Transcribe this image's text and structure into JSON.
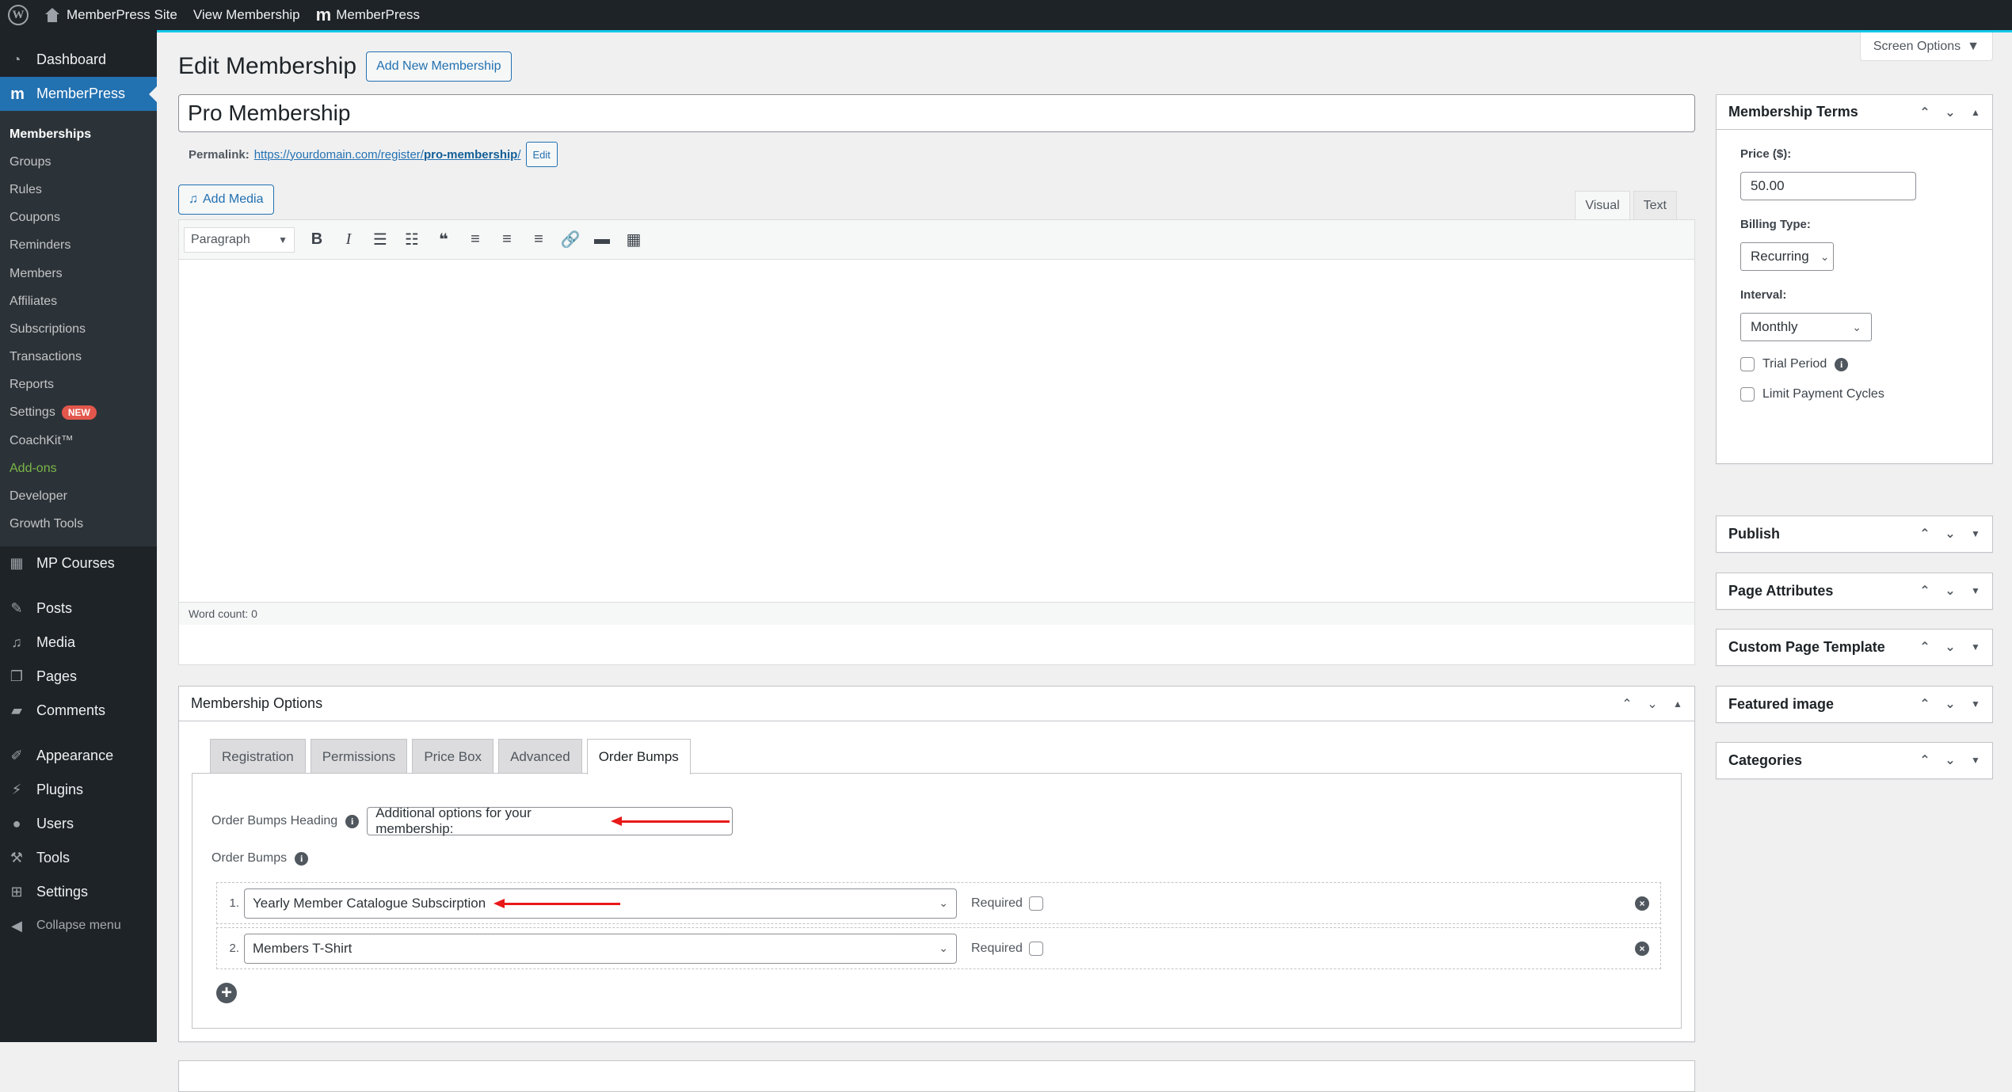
{
  "adminbar": {
    "site_name": "MemberPress Site",
    "view_link": "View Membership",
    "plugin_link": "MemberPress"
  },
  "sidebar": {
    "top_items": [
      {
        "label": "Dashboard",
        "icon": "dashboard-icon"
      },
      {
        "label": "MemberPress",
        "icon": "memberpress-icon",
        "active": true
      }
    ],
    "submenu": [
      {
        "label": "Memberships",
        "current": true
      },
      {
        "label": "Groups"
      },
      {
        "label": "Rules"
      },
      {
        "label": "Coupons"
      },
      {
        "label": "Reminders"
      },
      {
        "label": "Members"
      },
      {
        "label": "Affiliates"
      },
      {
        "label": "Subscriptions"
      },
      {
        "label": "Transactions"
      },
      {
        "label": "Reports"
      },
      {
        "label": "Settings",
        "badge": "NEW"
      },
      {
        "label": "CoachKit™"
      },
      {
        "label": "Add-ons",
        "color": "#7ab648"
      },
      {
        "label": "Developer"
      },
      {
        "label": "Growth Tools"
      }
    ],
    "mp_courses": "MP Courses",
    "bottom_items": [
      {
        "label": "Posts",
        "icon": "pin-icon"
      },
      {
        "label": "Media",
        "icon": "media-icon"
      },
      {
        "label": "Pages",
        "icon": "pages-icon"
      },
      {
        "label": "Comments",
        "icon": "comment-icon"
      },
      {
        "label": "Appearance",
        "icon": "brush-icon"
      },
      {
        "label": "Plugins",
        "icon": "plug-icon"
      },
      {
        "label": "Users",
        "icon": "user-icon"
      },
      {
        "label": "Tools",
        "icon": "wrench-icon"
      },
      {
        "label": "Settings",
        "icon": "settings-icon"
      }
    ],
    "collapse": "Collapse menu"
  },
  "header": {
    "title": "Edit Membership",
    "add_new": "Add New Membership",
    "screen_options": "Screen Options"
  },
  "post": {
    "title": "Pro Membership",
    "permalink_label": "Permalink:",
    "permalink_base": "https://yourdomain.com/register/",
    "permalink_slug": "pro-membership",
    "permalink_trail": "/",
    "permalink_edit": "Edit"
  },
  "editor": {
    "add_media": "Add Media",
    "tabs": [
      "Visual",
      "Text"
    ],
    "active_tab": "Visual",
    "format": "Paragraph",
    "word_count": "Word count: 0"
  },
  "membership_options": {
    "title": "Membership Options",
    "tabs": [
      "Registration",
      "Permissions",
      "Price Box",
      "Advanced",
      "Order Bumps"
    ],
    "active_tab": "Order Bumps",
    "heading_label": "Order Bumps Heading",
    "heading_value": "Additional options for your membership:",
    "bumps_label": "Order Bumps",
    "required_label": "Required",
    "bumps": [
      {
        "num": "1.",
        "value": "Yearly Member Catalogue Subscirption",
        "required": false
      },
      {
        "num": "2.",
        "value": "Members T-Shirt",
        "required": false
      }
    ]
  },
  "membership_terms": {
    "title": "Membership Terms",
    "price_label": "Price ($):",
    "price_value": "50.00",
    "billing_label": "Billing Type:",
    "billing_value": "Recurring",
    "interval_label": "Interval:",
    "interval_value": "Monthly",
    "trial_label": "Trial Period",
    "limit_label": "Limit Payment Cycles"
  },
  "side_boxes": [
    "Publish",
    "Page Attributes",
    "Custom Page Template",
    "Featured image",
    "Categories"
  ],
  "annotation_color": "#e81919",
  "accent_color": "#2271b1"
}
